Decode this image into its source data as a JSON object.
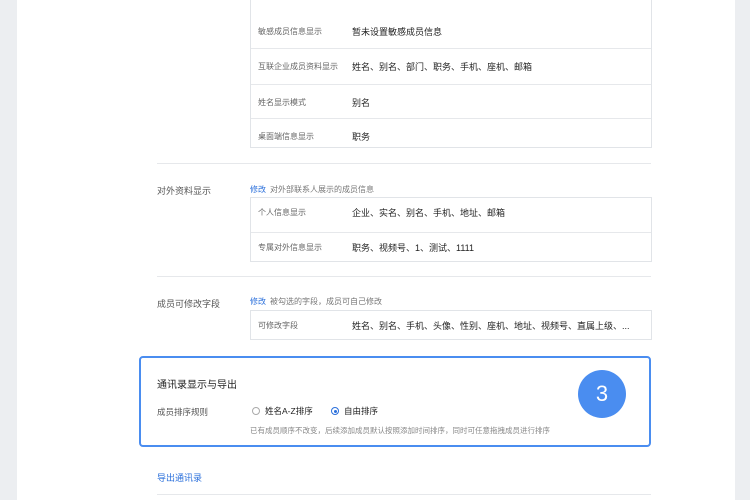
{
  "top_group": {
    "rows": [
      {
        "label": "敏感成员信息显示",
        "value": "暂未设置敏感成员信息"
      },
      {
        "label": "互联企业成员资料显示",
        "value": "姓名、别名、部门、职务、手机、座机、邮箱"
      },
      {
        "label": "姓名显示模式",
        "value": "别名"
      },
      {
        "label": "桌面端信息显示",
        "value": "职务"
      }
    ]
  },
  "external_info": {
    "label": "对外资料显示",
    "edit_label": "修改",
    "hint": "对外部联系人展示的成员信息",
    "rows": [
      {
        "label": "个人信息显示",
        "value": "企业、实名、别名、手机、地址、邮箱"
      },
      {
        "label": "专属对外信息显示",
        "value": "职务、视频号、1、测试、1111"
      }
    ]
  },
  "editable_fields": {
    "label": "成员可修改字段",
    "edit_label": "修改",
    "hint": "被勾选的字段，成员可自己修改",
    "row": {
      "label": "可修改字段",
      "value": "姓名、别名、手机、头像、性别、座机、地址、视频号、直属上级、..."
    }
  },
  "directory_display": {
    "title": "通讯录显示与导出",
    "sort_label": "成员排序规则",
    "options": [
      {
        "label": "姓名A-Z排序",
        "checked": false
      },
      {
        "label": "自由排序",
        "checked": true
      }
    ],
    "note": "已有成员顺序不改变，后续添加成员默认按照添加时间排序，同时可任意拖拽成员进行排序",
    "step_badge": "3"
  },
  "export": {
    "link_label": "导出通讯录"
  },
  "colors": {
    "accent": "#4a8df0",
    "link": "#2a6fdb"
  }
}
